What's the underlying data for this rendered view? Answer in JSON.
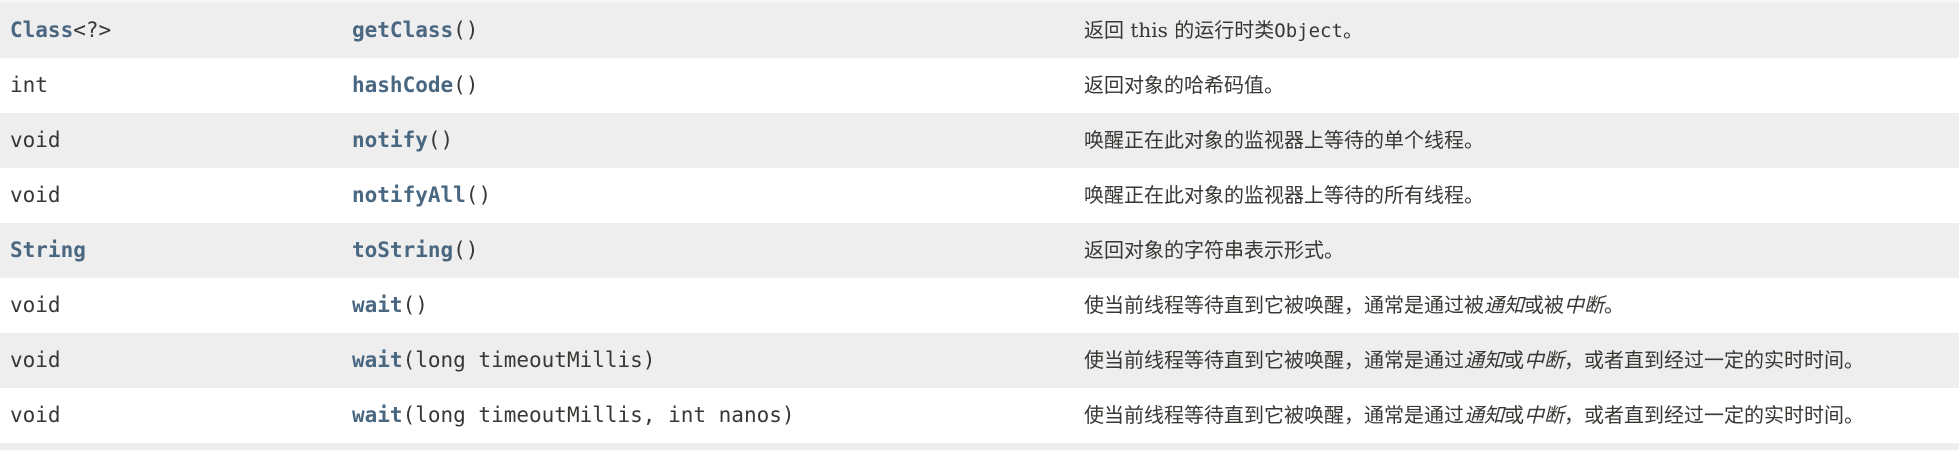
{
  "rows": [
    {
      "type_link": "Class",
      "type_suffix": "<?>",
      "method": "getClass",
      "params": "()",
      "desc": {
        "p1": "返回 ",
        "p1_serif": "this",
        "p2": " 的运行时类",
        "p2_code": "Object",
        "p3": "。"
      }
    },
    {
      "type": "int",
      "method": "hashCode",
      "params": "()",
      "desc": "返回对象的哈希码值。"
    },
    {
      "type": "void",
      "method": "notify",
      "params": "()",
      "desc": "唤醒正在此对象的监视器上等待的单个线程。"
    },
    {
      "type": "void",
      "method": "notifyAll",
      "params": "()",
      "desc": "唤醒正在此对象的监视器上等待的所有线程。"
    },
    {
      "type_link": "String",
      "method": "toString",
      "params": "()",
      "desc": "返回对象的字符串表示形式。"
    },
    {
      "type": "void",
      "method": "wait",
      "params": "()",
      "desc": {
        "p1": "使当前线程等待直到它被唤醒，通常是通过被",
        "em1": "通知",
        "p2": "或被",
        "em2": "中断",
        "p3": "。"
      }
    },
    {
      "type": "void",
      "method": "wait",
      "params": "(long timeoutMillis)",
      "desc": {
        "p1": "使当前线程等待直到它被唤醒，通常是通过",
        "em1": "通知",
        "p2": "或",
        "em2": "中断",
        "p3": "，或者直到经过一定的实时时间。"
      }
    },
    {
      "type": "void",
      "method": "wait",
      "params": "(long timeoutMillis, int nanos)",
      "desc": {
        "p1": "使当前线程等待直到它被唤醒，通常是通过",
        "em1": "通知",
        "p2": "或",
        "em2": "中断",
        "p3": "，或者直到经过一定的实时时间。"
      }
    }
  ]
}
